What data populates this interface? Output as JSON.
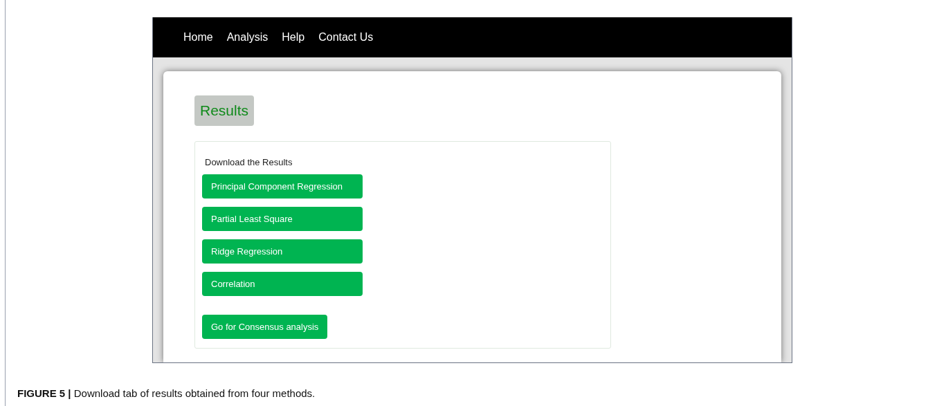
{
  "nav": {
    "items": [
      "Home",
      "Analysis",
      "Help",
      "Contact Us"
    ]
  },
  "page": {
    "title": "Results"
  },
  "panel": {
    "heading": "Download the Results",
    "downloads": [
      "Principal Component Regression",
      "Partial Least Square",
      "Ridge Regression",
      "Correlation"
    ],
    "action": "Go for Consensus analysis"
  },
  "caption": "**FIGURE 5 |** Download tab of results obtained from four methods."
}
